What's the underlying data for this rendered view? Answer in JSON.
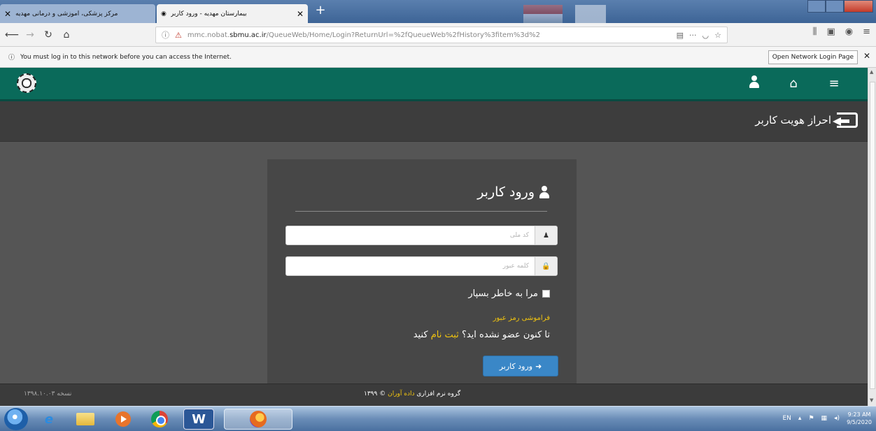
{
  "browser": {
    "tabs": [
      {
        "label": "مرکز پزشکی، آموزشی و درمانی مهدیه"
      },
      {
        "label": "بیمارستان مهدیه - ورود کاربر"
      }
    ],
    "new_tab_glyph": "+",
    "url_prefix": "mmc.nobat.",
    "url_domain": "sbmu.ac.ir",
    "url_rest": "/QueueWeb/Home/Login?ReturnUrl=%2fQueueWeb%2fHistory%3fitem%3d%2",
    "url_more": "···",
    "notice_text": "You must log in to this network before you can access the Internet.",
    "notice_button": "Open Network Login Page",
    "notice_close": "✕"
  },
  "app": {
    "page_header": "احراز هویت کاربر",
    "login": {
      "title": "ورود کاربر",
      "username_placeholder": "کد ملی",
      "password_placeholder": "کلمه عبور",
      "remember_label": "مرا به خاطر بسپار",
      "forgot_link": "فراموشی رمز عبور",
      "not_member_text": "تا کنون عضو نشده اید؟",
      "register_link": "ثبت نام",
      "register_suffix": "کنید",
      "submit_label": "ورود کاربر"
    },
    "footer": {
      "version": "نسخه ۱۳۹۸.۱۰.۰۳",
      "credit_prefix": "گروه نرم افزاری",
      "credit_team": "داده آوران",
      "credit_year": "۱۳۹۹"
    }
  },
  "taskbar": {
    "tray_lang": "EN",
    "clock_time": "9:23 AM",
    "clock_date": "9/5/2020"
  },
  "colors": {
    "appbar": "#0a6a5a",
    "accent_link": "#f1c40f",
    "button": "#3a87c7"
  }
}
